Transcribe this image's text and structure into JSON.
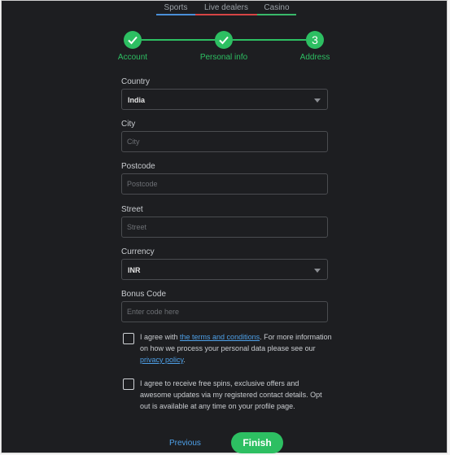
{
  "top_tabs": [
    "Sports",
    "Live dealers",
    "Casino"
  ],
  "colors": {
    "accent": "#2dbf62",
    "link": "#4ea0e8",
    "sports": "#4a8fd8",
    "live": "#d64545",
    "casino": "#39b86a"
  },
  "steps": [
    {
      "label": "Account",
      "state": "done",
      "icon": "check-icon"
    },
    {
      "label": "Personal info",
      "state": "done",
      "icon": "check-icon"
    },
    {
      "label": "Address",
      "state": "active",
      "number": "3"
    }
  ],
  "form": {
    "country": {
      "label": "Country",
      "value": "India"
    },
    "city": {
      "label": "City",
      "placeholder": "City"
    },
    "postcode": {
      "label": "Postcode",
      "placeholder": "Postcode"
    },
    "street": {
      "label": "Street",
      "placeholder": "Street"
    },
    "currency": {
      "label": "Currency",
      "value": "INR"
    },
    "bonus": {
      "label": "Bonus Code",
      "placeholder": "Enter code here"
    }
  },
  "agreements": {
    "terms_prefix": "I agree with ",
    "terms_link": "the terms and conditions",
    "terms_mid": ". For more information on how we process your personal data please see our ",
    "privacy_link": "privacy policy",
    "terms_suffix": ".",
    "marketing": "I agree to receive free spins, exclusive offers and awesome updates via my registered contact details. Opt out is available at any time on your profile page."
  },
  "actions": {
    "previous": "Previous",
    "finish": "Finish"
  }
}
